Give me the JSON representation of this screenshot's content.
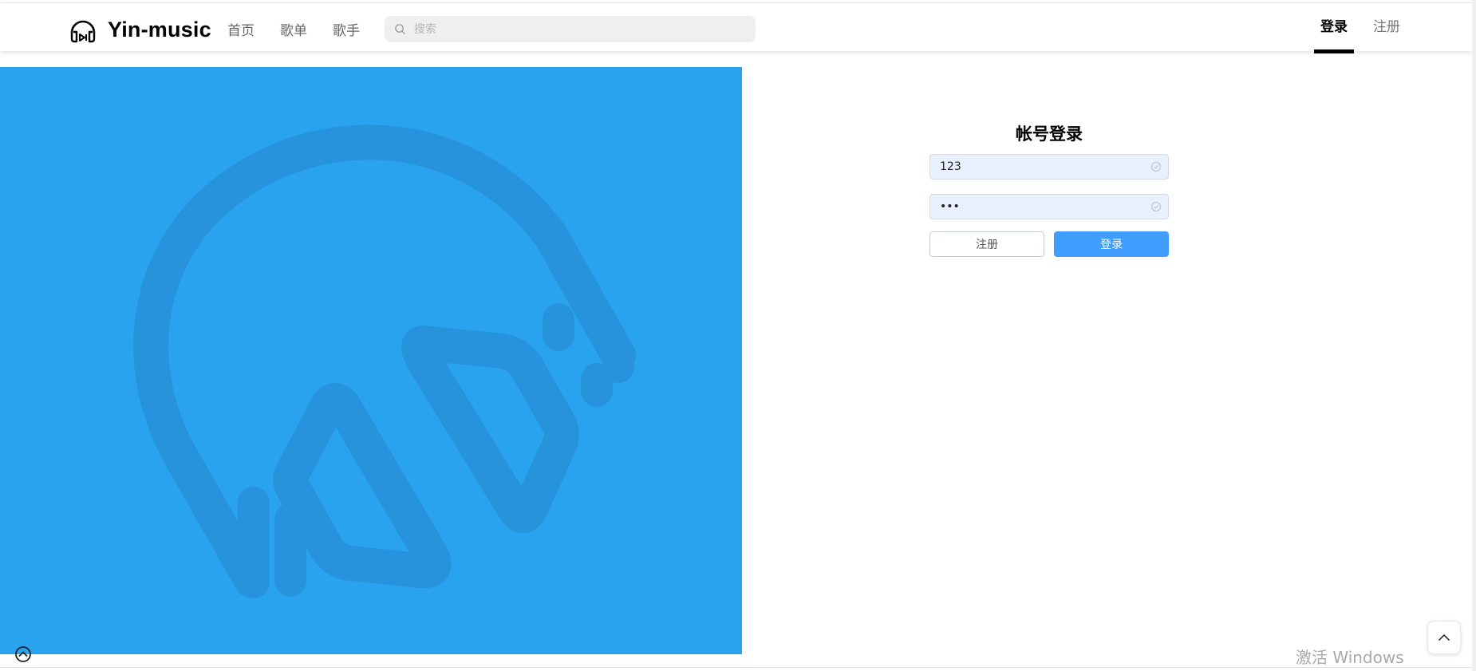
{
  "header": {
    "brand": "Yin-music",
    "nav": [
      "首页",
      "歌单",
      "歌手"
    ],
    "search_placeholder": "搜索",
    "right": {
      "login": "登录",
      "register": "注册"
    }
  },
  "login_form": {
    "title": "帐号登录",
    "username_value": "123",
    "password_value": "•••",
    "register_button": "注册",
    "login_button": "登录"
  },
  "system": {
    "watermark": "激活 Windows"
  },
  "colors": {
    "hero_bg": "#2aa3ef",
    "primary": "#409eff"
  },
  "icons": {
    "logo": "headphones-icon",
    "search": "search-icon",
    "field_status": "check-circle-icon",
    "scroll_top": "chevron-up-icon",
    "bottom_left": "chevron-up-circle-icon"
  }
}
